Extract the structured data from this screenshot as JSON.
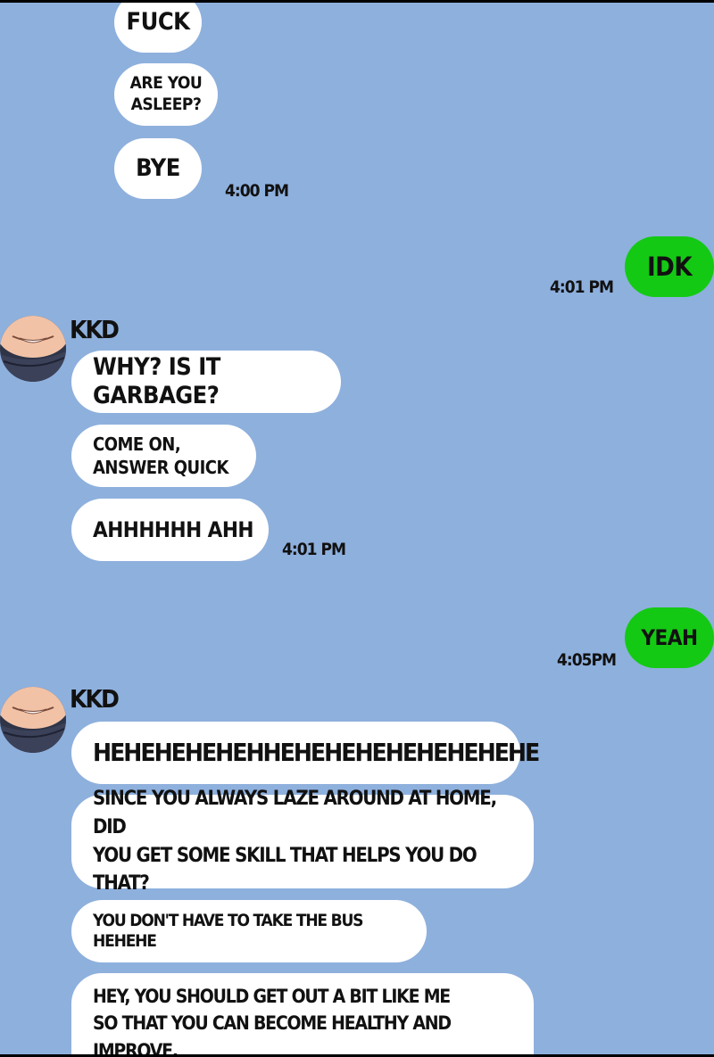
{
  "colors": {
    "background": "#8eb0dd",
    "incoming_bubble": "#ffffff",
    "outgoing_bubble": "#14c914",
    "text": "#111111"
  },
  "messages": {
    "m1": "FUCK",
    "m2": "ARE YOU\nASLEEP?",
    "m3": "BYE",
    "t1": "4:00 PM",
    "m4": "IDK",
    "t2": "4:01 PM",
    "sender1": "KKD",
    "m5": "WHY? IS IT GARBAGE?",
    "m6": "COME ON,\nANSWER QUICK",
    "m7": "AHHHHHH AHH",
    "t3": "4:01 PM",
    "m8": "YEAH",
    "t4": "4:05PM",
    "sender2": "KKD",
    "m9": "HEHEHEHEHEHHEHEHEHEHEHEHEHEHE",
    "m10": "SINCE YOU ALWAYS LAZE AROUND AT HOME, DID\nYOU GET SOME SKILL THAT HELPS YOU DO THAT?",
    "m11": "YOU DON'T HAVE TO TAKE THE BUS HEHEHE",
    "m12": "HEY, YOU SHOULD GET OUT A BIT LIKE ME\nSO THAT YOU CAN BECOME HEALTHY AND IMPROVE."
  },
  "icons": {
    "avatar": "kkd-avatar-icon"
  }
}
